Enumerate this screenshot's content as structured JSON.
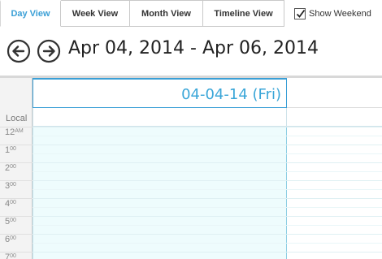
{
  "toolbar": {
    "tabs": [
      {
        "label": "Day View",
        "active": true
      },
      {
        "label": "Week View",
        "active": false
      },
      {
        "label": "Month View",
        "active": false
      },
      {
        "label": "Timeline View",
        "active": false
      }
    ],
    "show_weekend": {
      "label": "Show Weekend",
      "checked": true
    }
  },
  "navigator": {
    "prev_icon": "arrow-left-circle-icon",
    "next_icon": "arrow-right-circle-icon",
    "date_range": "Apr 04, 2014 - Apr 06, 2014"
  },
  "calendar": {
    "timezone_label": "Local",
    "day_header": "04-04-14 (Fri)",
    "hours": [
      {
        "hour": "12",
        "suffix": "AM"
      },
      {
        "hour": "1",
        "suffix": "00"
      },
      {
        "hour": "2",
        "suffix": "00"
      },
      {
        "hour": "3",
        "suffix": "00"
      },
      {
        "hour": "4",
        "suffix": "00"
      },
      {
        "hour": "5",
        "suffix": "00"
      },
      {
        "hour": "6",
        "suffix": "00"
      },
      {
        "hour": "7",
        "suffix": "00"
      }
    ]
  },
  "colors": {
    "accent": "#3a9fd6",
    "day_column_bg": "#eefcfd",
    "time_column_bg": "#f3f3f3"
  }
}
